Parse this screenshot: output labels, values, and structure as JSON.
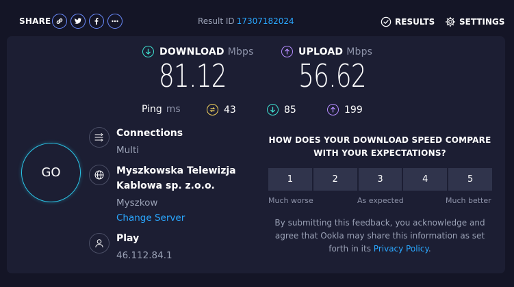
{
  "header": {
    "share_label": "SHARE",
    "share_icons": [
      "link-icon",
      "twitter-icon",
      "facebook-icon",
      "more-icon"
    ],
    "result_prefix": "Result ID",
    "result_id": "17307182024",
    "results_label": "RESULTS",
    "settings_label": "SETTINGS"
  },
  "download": {
    "label": "DOWNLOAD",
    "unit": "Mbps",
    "value": "81.12",
    "color": "#3ee0d0"
  },
  "upload": {
    "label": "UPLOAD",
    "unit": "Mbps",
    "value": "56.62",
    "color": "#b58cff"
  },
  "ping": {
    "label": "Ping",
    "unit": "ms",
    "idle": "43",
    "download": "85",
    "upload": "199",
    "idle_color": "#f4d35e"
  },
  "go_label": "GO",
  "connections": {
    "title": "Connections",
    "value": "Multi"
  },
  "server": {
    "name_line1": "Myszkowska Telewizja",
    "name_line2": "Kablowa sp. z.o.o.",
    "location": "Myszkow",
    "change_label": "Change Server"
  },
  "provider": {
    "name": "Play",
    "ip": "46.112.84.1"
  },
  "feedback": {
    "question_line1": "HOW DOES YOUR DOWNLOAD SPEED COMPARE",
    "question_line2": "WITH YOUR EXPECTATIONS?",
    "ratings": [
      "1",
      "2",
      "3",
      "4",
      "5"
    ],
    "low_label": "Much worse",
    "mid_label": "As expected",
    "high_label": "Much better",
    "note_line1": "By submitting this feedback, you acknowledge and",
    "note_line2": "agree that Ookla may share this information as set",
    "note_line3_prefix": "forth in its",
    "privacy_link": "Privacy Policy",
    "note_line3_suffix": "."
  },
  "colors": {
    "accent": "#2aa7ff",
    "background": "#141526",
    "panel": "#1c1e33",
    "go_ring": "#2ac4e6"
  }
}
